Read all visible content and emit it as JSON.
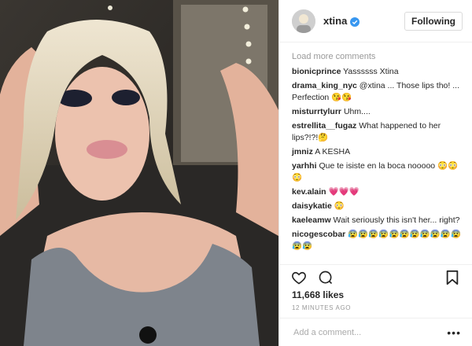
{
  "post": {
    "username": "xtina",
    "follow_label": "Following",
    "load_more": "Load more comments",
    "likes": "11,668 likes",
    "time": "12 MINUTES AGO",
    "add_comment_placeholder": "Add a comment...",
    "more_label": "•••"
  },
  "comments": [
    {
      "user": "bionicprince",
      "text": "Yassssss Xtina"
    },
    {
      "user": "drama_king_nyc",
      "text": "@xtina ... Those lips tho! ... Perfection 😘😘"
    },
    {
      "user": "misturrtylurr",
      "text": "Uhm...."
    },
    {
      "user": "estrellita__fugaz",
      "text": "What happened to her lips?!?!🤔"
    },
    {
      "user": "jmniz",
      "text": "A KESHA"
    },
    {
      "user": "yarhhi",
      "text": "Que te isiste en la boca nooooo 😳😳😳"
    },
    {
      "user": "kev.alain",
      "text": "💗💗💗"
    },
    {
      "user": "daisykatie",
      "text": "😳"
    },
    {
      "user": "kaeleamw",
      "text": "Wait seriously this isn't her... right?"
    },
    {
      "user": "nicogescobar",
      "text": "😰😰😰😰😰😰😰😰😰😰😰😰😰"
    }
  ],
  "icons": {
    "verified": "verified-badge",
    "like": "heart-outline",
    "comment": "speech-bubble",
    "save": "bookmark"
  },
  "colors": {
    "verified": "#3897f0",
    "text": "#262626",
    "muted": "#999999"
  }
}
